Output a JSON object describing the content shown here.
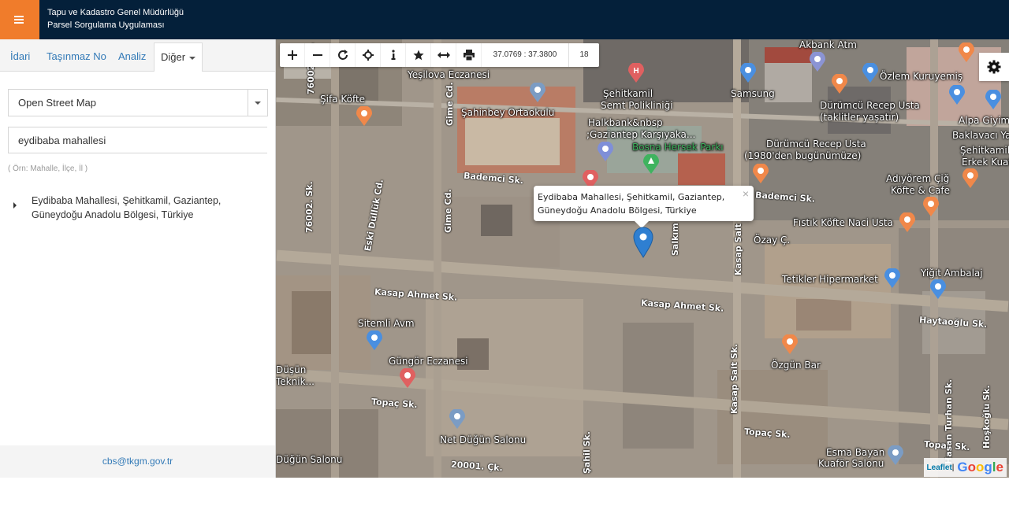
{
  "header": {
    "menu_icon": "hamburger-icon",
    "title_line1": "Tapu ve Kadastro Genel Müdürlüğü",
    "title_line2": "Parsel Sorgulama Uygulaması"
  },
  "sidebar": {
    "tabs": [
      {
        "label": "İdari"
      },
      {
        "label": "Taşınmaz No"
      },
      {
        "label": "Analiz"
      },
      {
        "label": "Diğer"
      }
    ],
    "layer_select": {
      "value": "Open Street Map"
    },
    "search": {
      "value": "eydibaba mahallesi",
      "hint": "( Örn: Mahalle, İlçe, İl )"
    },
    "results": [
      {
        "line1": "Eydibaba Mahallesi, Şehitkamil, Gaziantep,",
        "line2": "Güneydoğu Anadolu Bölgesi, Türkiye"
      }
    ],
    "footer_email": "cbs@tkgm.gov.tr"
  },
  "map": {
    "toolbar": {
      "icons": [
        "zoom-in-icon",
        "zoom-out-icon",
        "refresh-icon",
        "locate-icon",
        "info-icon",
        "star-icon",
        "measure-icon",
        "print-icon"
      ],
      "coordinates": "37.0769 : 37.3800",
      "zoom": "18"
    },
    "popup": {
      "line1": "Eydibaba Mahallesi, Şehitkamil, Gaziantep,",
      "line2": "Güneydoğu Anadolu Bölgesi, Türkiye",
      "close": "×"
    },
    "attribution": {
      "leaflet": "Leaflet",
      "sep": " | ",
      "google": "Google"
    },
    "places": [
      {
        "name": "Yeşilova Eczanesi"
      },
      {
        "name": "Şifa Köfte"
      },
      {
        "name": "Şahinbey Ortaokulu"
      },
      {
        "name": "Şehitkamil"
      },
      {
        "name": "Semt Polikliniği"
      },
      {
        "name": "Halkbank&nbsp"
      },
      {
        "name": ";Gaziantep Karşıyaka..."
      },
      {
        "name": "Bosna Hersek Parkı"
      },
      {
        "name": "Samsung"
      },
      {
        "name": "Akbank Atm"
      },
      {
        "name": "Özlem Kuruyemiş"
      },
      {
        "name": "Dürümcü Recep Usta"
      },
      {
        "name": "(taklitler yaşatır)"
      },
      {
        "name": "Alpa Giyim"
      },
      {
        "name": "Baklavacı Yaşar"
      },
      {
        "name": "Dürümcü Recep Usta"
      },
      {
        "name": "(1980'den bugünümüze)"
      },
      {
        "name": "Şehitkamil"
      },
      {
        "name": "Erkek Kuaför"
      },
      {
        "name": "Adıyörem Çiğ"
      },
      {
        "name": "Köfte & Cafe"
      },
      {
        "name": "Fıstık Köfte Naci Usta"
      },
      {
        "name": "Özay Ç."
      },
      {
        "name": "Tetikler Hipermarket"
      },
      {
        "name": "Yiğit Ambalaj"
      },
      {
        "name": "Sitemli Avm"
      },
      {
        "name": "Güngör Eczanesi"
      },
      {
        "name": "Özgün Bar"
      },
      {
        "name": "Düşün"
      },
      {
        "name": "Teknik..."
      },
      {
        "name": "Net Düğün Salonu"
      },
      {
        "name": "Düğün Salonu"
      },
      {
        "name": "Esma Bayan"
      },
      {
        "name": "Kuaför Salonu"
      }
    ],
    "streets": [
      {
        "name": "76002. Sk."
      },
      {
        "name": "Gime Cd."
      },
      {
        "name": "Bademci Sk."
      },
      {
        "name": "Bademci Sk."
      },
      {
        "name": "Eski Düllük Cd."
      },
      {
        "name": "Salkım"
      },
      {
        "name": "Kasap Sait Sk."
      },
      {
        "name": "Kasap Ahmet Sk."
      },
      {
        "name": "Kasap Ahmet Sk."
      },
      {
        "name": "Haytaoğlu Sk."
      },
      {
        "name": "Topaç Sk."
      },
      {
        "name": "Topaç Sk."
      },
      {
        "name": "Topaç Sk."
      },
      {
        "name": "Kasap Sait Sk."
      },
      {
        "name": "Hasan Turhan Sk."
      },
      {
        "name": "Hoşkoğlu Sk."
      },
      {
        "name": "Şahil Sk."
      },
      {
        "name": "20001. Çk."
      },
      {
        "name": "76002. Sk."
      },
      {
        "name": "Gime Cd."
      }
    ]
  }
}
